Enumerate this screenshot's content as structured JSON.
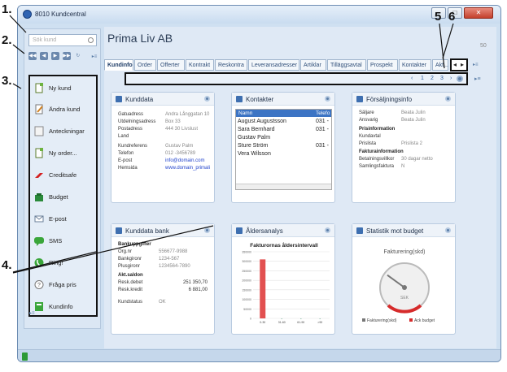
{
  "callouts": [
    "1.",
    "2.",
    "3.",
    "4.",
    "5",
    "6"
  ],
  "window": {
    "title": "8010 Kundcentral",
    "minimize": "–",
    "maximize": "□",
    "close": "✕"
  },
  "sidebar": {
    "search_placeholder": "Sök kund",
    "nav_buttons": [
      "◀◀",
      "◀",
      "▶",
      "▶▶",
      "↻"
    ],
    "nav_more": "▸≡",
    "items": [
      {
        "label": "Ny kund",
        "icon": "new-customer-icon"
      },
      {
        "label": "Ändra kund",
        "icon": "edit-customer-icon"
      },
      {
        "label": "Anteckningar",
        "icon": "notes-icon"
      },
      {
        "label": "Ny order...",
        "icon": "new-order-icon"
      },
      {
        "label": "Creditsafe",
        "icon": "creditsafe-icon"
      },
      {
        "label": "Budget",
        "icon": "budget-icon"
      },
      {
        "label": "E-post",
        "icon": "email-icon"
      },
      {
        "label": "SMS",
        "icon": "sms-icon"
      },
      {
        "label": "Ring!",
        "icon": "phone-icon"
      },
      {
        "label": "Fråga pris",
        "icon": "price-question-icon"
      },
      {
        "label": "Kundinfo",
        "icon": "customer-info-icon"
      }
    ],
    "list_more": "▸≡"
  },
  "main": {
    "title": "Prima Liv AB",
    "top_right": "50",
    "tabs": [
      "Kundinfo",
      "Order",
      "Offerter",
      "Kontrakt",
      "Reskontra",
      "Leveransadresser",
      "Artiklar",
      "Tilläggsavtal",
      "Prospekt",
      "Kontakter",
      "Akt..."
    ],
    "tab_scroll_left": "◂",
    "tab_scroll_right": "▸",
    "tab_more": "▸≡",
    "pager": {
      "prev": "‹",
      "pages": [
        "1",
        "2",
        "3"
      ],
      "next": "›",
      "more": "▸≡"
    }
  },
  "panels": {
    "kunddata": {
      "title": "Kunddata",
      "rows": [
        {
          "k": "Gatuadress",
          "v": "Andra Långgatan 10"
        },
        {
          "k": "Utdelningsadress",
          "v": "Box 33"
        },
        {
          "k": "Postadress",
          "v": "444 30 Livslust"
        },
        {
          "k": "Land",
          "v": ""
        },
        {
          "k": "Kundreferens",
          "v": "Gustav Palm"
        },
        {
          "k": "Telefon",
          "v": "012 -3456789"
        },
        {
          "k": "E-post",
          "v": "info@domain.com"
        },
        {
          "k": "Hemsida",
          "v": "www.domain_primali"
        }
      ]
    },
    "kontakter": {
      "title": "Kontakter",
      "col_name": "Namn",
      "col_phone": "Telefo",
      "rows": [
        {
          "name": "August Augustsson",
          "phone": "031 -"
        },
        {
          "name": "Sara Bernhard",
          "phone": "031 -"
        },
        {
          "name": "Gustav Palm",
          "phone": ""
        },
        {
          "name": "Sture Ström",
          "phone": "031 -"
        },
        {
          "name": "Vera Wilsson",
          "phone": ""
        }
      ]
    },
    "forsaljning": {
      "title": "Försäljningsinfo",
      "rows": [
        {
          "k": "Säljare",
          "v": "Beata Julin"
        },
        {
          "k": "Ansvarig",
          "v": "Beata Julin"
        }
      ],
      "sec_price": "Prisinformation",
      "price_rows": [
        {
          "k": "Kundavtal",
          "v": ""
        },
        {
          "k": "Prislista",
          "v": "Prislista 2"
        }
      ],
      "sec_invoice": "Fakturainformation",
      "invoice_rows": [
        {
          "k": "Betalningsvillkor",
          "v": "30 dagar netto"
        },
        {
          "k": "Samlingsfaktura",
          "v": "N"
        }
      ]
    },
    "bank": {
      "title": "Kunddata bank",
      "sec_bank": "Bankuppgifter",
      "bank_rows": [
        {
          "k": "Org.nr",
          "v": "556677-9988"
        },
        {
          "k": "Bankgironr",
          "v": "1234-567"
        },
        {
          "k": "Plusgironr",
          "v": "1234564-7890"
        }
      ],
      "sec_saldo": "Akt.saldon",
      "saldo_rows": [
        {
          "k": "Resk.debet",
          "v": "251 350,70"
        },
        {
          "k": "Resk.kredit",
          "v": "6 881,00"
        }
      ],
      "status_k": "Kundstatus",
      "status_v": "OK"
    },
    "aldersanalys": {
      "title": "Åldersanalys"
    },
    "statistik": {
      "title": "Statistik mot budget"
    }
  },
  "chart_data": [
    {
      "type": "bar",
      "title": "Fakturornas åldersintervall",
      "y_ticks": [
        "350000",
        "300000",
        "250000",
        "200000",
        "150000",
        "100000",
        "50000",
        "0"
      ],
      "categories": [
        "0-30",
        "31-60",
        "61-90",
        ">90"
      ],
      "values": [
        310000,
        0,
        0,
        0
      ],
      "ylim": [
        0,
        350000
      ]
    },
    {
      "type": "gauge",
      "title": "Fakturering(skd)",
      "unit": "SEK",
      "value_pct": 0.3,
      "legend": [
        "Fakturering(skd)",
        "Ack budget"
      ],
      "colors": {
        "needle": "#777777",
        "budget_zone": "#d62b2b"
      }
    }
  ],
  "statusbar": {
    "icon": "status-ok-icon"
  }
}
